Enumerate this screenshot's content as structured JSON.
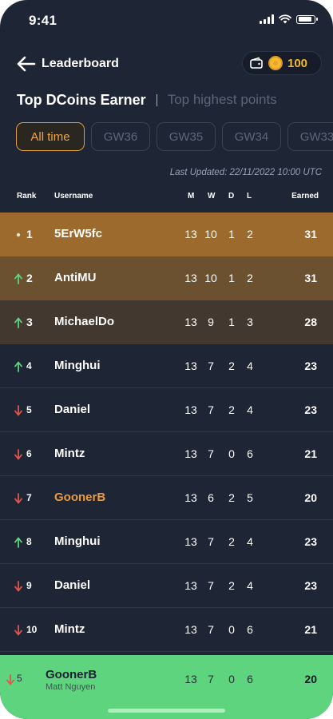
{
  "status_bar": {
    "time": "9:41"
  },
  "header": {
    "title": "Leaderboard",
    "coins": "100"
  },
  "section_tabs": {
    "active": "Top DCoins Earner",
    "inactive": "Top highest points"
  },
  "filters": [
    "All time",
    "GW36",
    "GW35",
    "GW34",
    "GW33"
  ],
  "last_updated": "Last Updated: 22/11/2022 10:00 UTC",
  "columns": {
    "rank": "Rank",
    "username": "Username",
    "m": "M",
    "w": "W",
    "d": "D",
    "l": "L",
    "earned": "Earned"
  },
  "rows": [
    {
      "rank": "1",
      "trend": "same",
      "username": "5ErW5fc",
      "m": "13",
      "w": "10",
      "d": "1",
      "l": "2",
      "earned": "31"
    },
    {
      "rank": "2",
      "trend": "up",
      "username": "AntiMU",
      "m": "13",
      "w": "10",
      "d": "1",
      "l": "2",
      "earned": "31"
    },
    {
      "rank": "3",
      "trend": "up",
      "username": "MichaelDo",
      "m": "13",
      "w": "9",
      "d": "1",
      "l": "3",
      "earned": "28"
    },
    {
      "rank": "4",
      "trend": "up",
      "username": "Minghui",
      "m": "13",
      "w": "7",
      "d": "2",
      "l": "4",
      "earned": "23"
    },
    {
      "rank": "5",
      "trend": "down",
      "username": "Daniel",
      "m": "13",
      "w": "7",
      "d": "2",
      "l": "4",
      "earned": "23"
    },
    {
      "rank": "6",
      "trend": "down",
      "username": "Mintz",
      "m": "13",
      "w": "7",
      "d": "0",
      "l": "6",
      "earned": "21"
    },
    {
      "rank": "7",
      "trend": "down",
      "username": "GoonerB",
      "m": "13",
      "w": "6",
      "d": "2",
      "l": "5",
      "earned": "20"
    },
    {
      "rank": "8",
      "trend": "up",
      "username": "Minghui",
      "m": "13",
      "w": "7",
      "d": "2",
      "l": "4",
      "earned": "23"
    },
    {
      "rank": "9",
      "trend": "down",
      "username": "Daniel",
      "m": "13",
      "w": "7",
      "d": "2",
      "l": "4",
      "earned": "23"
    },
    {
      "rank": "10",
      "trend": "down",
      "username": "Mintz",
      "m": "13",
      "w": "7",
      "d": "0",
      "l": "6",
      "earned": "21"
    }
  ],
  "my_rank": {
    "rank": "5",
    "trend": "down",
    "username": "GoonerB",
    "full_name": "Matt Nguyen",
    "m": "13",
    "w": "7",
    "d": "0",
    "l": "6",
    "earned": "20"
  },
  "colors": {
    "up": "#5ed47e",
    "down": "#e0564e",
    "same": "#e9e2d4",
    "highlight": "#e79b3f"
  }
}
